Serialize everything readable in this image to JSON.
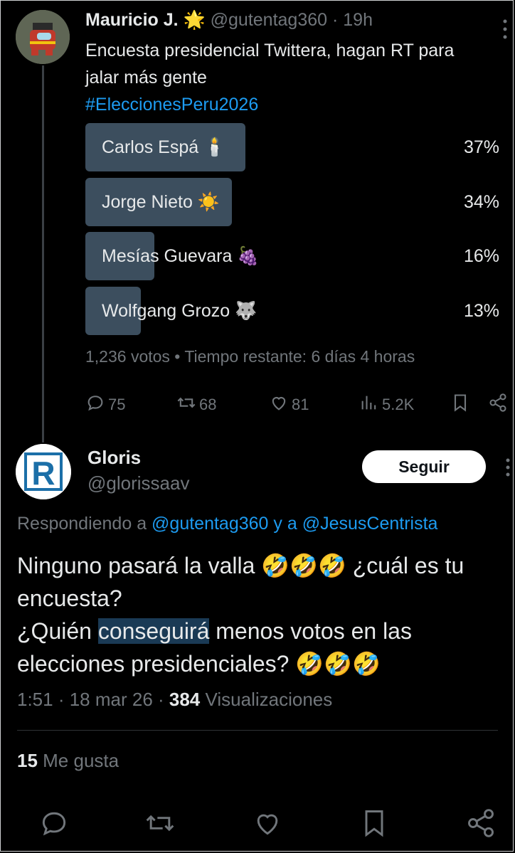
{
  "tweet": {
    "author_name": "Mauricio J.",
    "author_badge": "🌟",
    "handle": "@gutentag360",
    "time": "19h",
    "text_line1": "Encuesta presidencial Twittera, hagan RT para",
    "text_line2": "jalar más gente",
    "hashtag": "#EleccionesPeru2026",
    "poll": {
      "options": [
        {
          "label": "Carlos Espá 🕯️",
          "percent": "37%",
          "fraction": 0.37
        },
        {
          "label": "Jorge Nieto ☀️",
          "percent": "34%",
          "fraction": 0.34
        },
        {
          "label": "Mesías Guevara 🍇",
          "percent": "16%",
          "fraction": 0.16
        },
        {
          "label": "Wolfgang Grozo 🐺",
          "percent": "13%",
          "fraction": 0.13
        }
      ],
      "meta": "1,236 votos • Tiempo restante: 6 días 4 horas"
    },
    "actions": {
      "replies": "75",
      "retweets": "68",
      "likes": "81",
      "views": "5.2K"
    }
  },
  "reply": {
    "author_name": "Gloris",
    "handle": "@glorissaav",
    "avatar_letter": "R",
    "follow_label": "Seguir",
    "replying_prefix": "Respondiendo a",
    "replying_to_1": "@gutentag360",
    "replying_and": "y a",
    "replying_to_2": "@JesusCentrista",
    "text_part1": "Ninguno pasará la valla 🤣🤣🤣 ¿cuál es tu encuesta?",
    "text_part2a": "¿Quién ",
    "text_highlight": "conseguirá",
    "text_part2b": " menos votos en las elecciones presidenciales? 🤣🤣🤣",
    "time": "1:51 · 18 mar 26 · ",
    "views_count": "384",
    "views_label": " Visualizaciones",
    "likes_count": "15",
    "likes_label": " Me gusta"
  }
}
